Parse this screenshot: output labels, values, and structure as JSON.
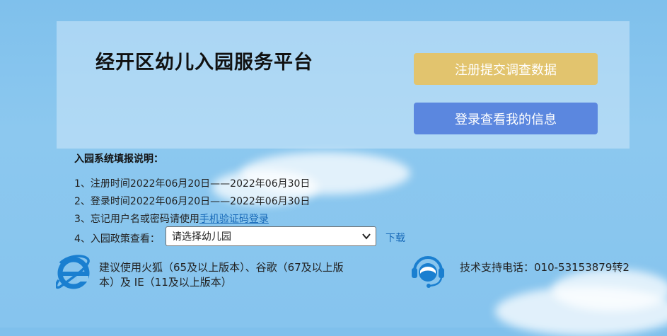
{
  "header": {
    "title": "经开区幼儿入园服务平台",
    "register_button": "注册提交调查数据",
    "login_button": "登录查看我的信息"
  },
  "instructions": {
    "title": "入园系统填报说明：",
    "line1": "1、注册时间2022年06月20日——2022年06月30日",
    "line2": "2、登录时间2022年06月20日——2022年06月30日",
    "line3_prefix": "3、忘记用户名或密码请使用",
    "line3_link": "手机验证码登录",
    "line4_prefix": "4、入园政策查看：",
    "select_value": "请选择幼儿园",
    "download_link": "下载"
  },
  "footer": {
    "browser_note": "建议使用火狐（65及以上版本）、谷歌（67及以上版本）及 IE（11及以上版本）",
    "support_text": "技术支持电话：010-53153879转2"
  },
  "colors": {
    "register_button": "#e2c46e",
    "login_button": "#5b87df",
    "link": "#1769b8",
    "ie_icon": "#1a7fd0"
  },
  "icons": [
    "ie-browser-icon",
    "customer-support-icon",
    "chevron-down-icon"
  ]
}
